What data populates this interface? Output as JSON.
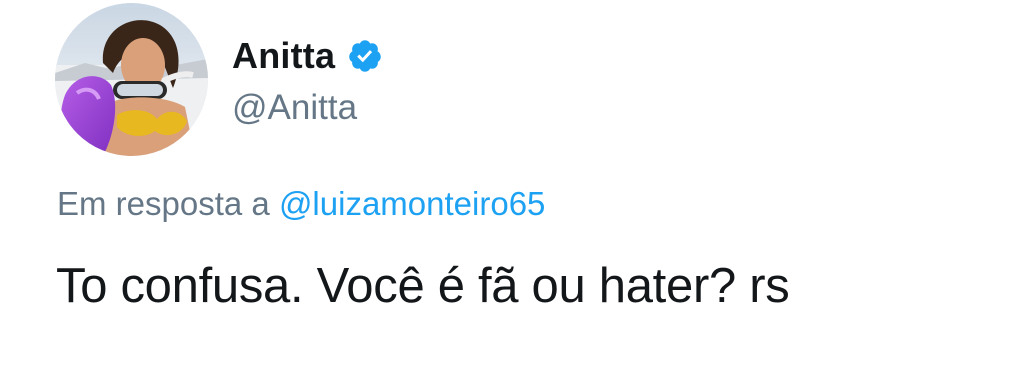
{
  "tweet": {
    "author": {
      "display_name": "Anitta",
      "handle": "@Anitta",
      "verified": true,
      "avatar_icon": "profile-photo"
    },
    "reply_prefix": "Em resposta a",
    "reply_to": "@luizamonteiro65",
    "text": "To confusa. Você é fã ou hater? rs"
  },
  "colors": {
    "text_primary": "#14171a",
    "text_secondary": "#657786",
    "link": "#1da1f2",
    "verified_badge": "#1da1f2"
  }
}
